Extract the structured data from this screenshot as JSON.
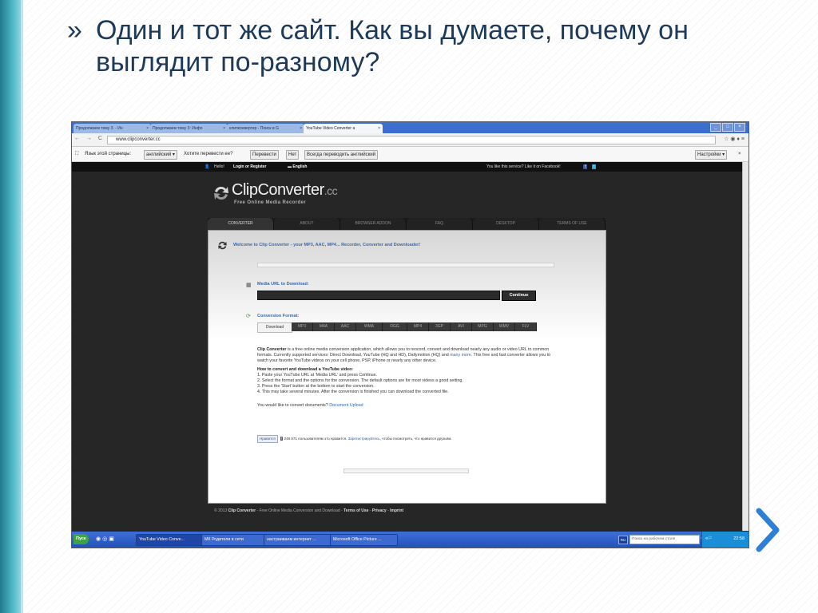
{
  "slide": {
    "bullet": "»",
    "title": "Один и тот же сайт. Как вы думаете, почему он выглядит по-разному?"
  },
  "browser": {
    "tabs": [
      {
        "label": "Продолжаем тему 3. - Ин",
        "close": "×"
      },
      {
        "label": "Продолжаем тему 3: Инфо",
        "close": "×"
      },
      {
        "label": "клипконвертер - Поиск в G",
        "close": "×"
      },
      {
        "label": "YouTube Video Converter a",
        "close": "×"
      }
    ],
    "window_buttons": [
      "_",
      "□",
      "×"
    ],
    "nav": "← → C",
    "url": "www.clipconverter.cc",
    "toolbar_icons": "☆ ◉ ♦ ≡"
  },
  "translate_bar": {
    "prompt": "Язык этой страницы:",
    "language": "английский ▾",
    "question": "Хотите перевести ее?",
    "translate": "Перевести",
    "no": "Нет",
    "always": "Всегда переводить английский",
    "settings": "Настройки ▾",
    "close": "×"
  },
  "site": {
    "topbar": {
      "hello": "Hello!",
      "login": "Login or Register",
      "language": "English",
      "like_prompt": "You like this service? Like it on Facebook!"
    },
    "logo": {
      "name": "ClipConverter",
      "suffix": ".cc",
      "tagline": "Free Online Media Recorder"
    },
    "menu": [
      "CONVERTER",
      "ABOUT",
      "BROWSER ADDON",
      "FAQ",
      "DESKTOP",
      "TERMS OF USE"
    ],
    "welcome": "Welcome to Clip Converter - your MP3, AAC, MP4... Recorder, Converter and Downloader!",
    "media_url_label": "Media URL to Download:",
    "continue_label": "Continue",
    "format_label": "Conversion Format:",
    "formats": [
      "Download",
      "MP3",
      "M4A",
      "AAC",
      "WMA",
      "OGG",
      "MP4",
      "3GP",
      "AVI",
      "MPG",
      "WMV",
      "FLV"
    ],
    "desc": {
      "name": "Clip Converter",
      "text1": " is a free online media conversion application, which allows you to reocord, convert and download nearly any audio or video URL to common formats. Currently supported services: Direct Download, YouTube (HQ and HD), Dailymotion (HQ) and ",
      "more": "many more",
      "text2": ". This free and fast converter allows you to watch your favorite YouTube videos on your cell phone, PSP, iPhone or nearly any other device.",
      "howto_title": "How to convert and download a YouTube video:",
      "steps": [
        "1. Paste your YouTube URL at 'Media URL' and press Continue.",
        "2. Select the format and the options for the conversion. The default options are for most videos a good setting.",
        "3. Press the 'Start' button at the bottom to start the conversion.",
        "4. This may take several minutes. After the conversion is finished you can download the converted file."
      ],
      "docs_prompt": "You would like to convert documents?",
      "docs_link": "Document Upload"
    },
    "facebook": {
      "like": "Нравится",
      "count": "248 571 пользователям это нравится.",
      "register": "Зарегистрируйтесь,",
      "rest": "чтобы посмотреть, что нравится друзьям."
    },
    "footer": {
      "copy": "© 2013",
      "brand": "Clip Converter",
      "desc": " - Free Online Media Conversion and Download - ",
      "terms": "Terms of Use",
      "privacy": "Privacy",
      "imprint": "Imprint"
    }
  },
  "taskbar": {
    "start": "Пуск",
    "items": [
      "YouTube Video Conve...",
      "МК Родители в сети",
      "настраиваем интернет ...",
      "Microsoft Office Picture ..."
    ],
    "lang": "RU",
    "search_placeholder": "Поиск на рабочем столе",
    "clock": "22:58"
  },
  "colors": {
    "slide_title": "#1d3a5a",
    "slide_accent": "#1f7a8c",
    "next_arrow": "#2e7fd6",
    "site_link": "#3a6aa8",
    "taskbar": "#2352b8"
  }
}
